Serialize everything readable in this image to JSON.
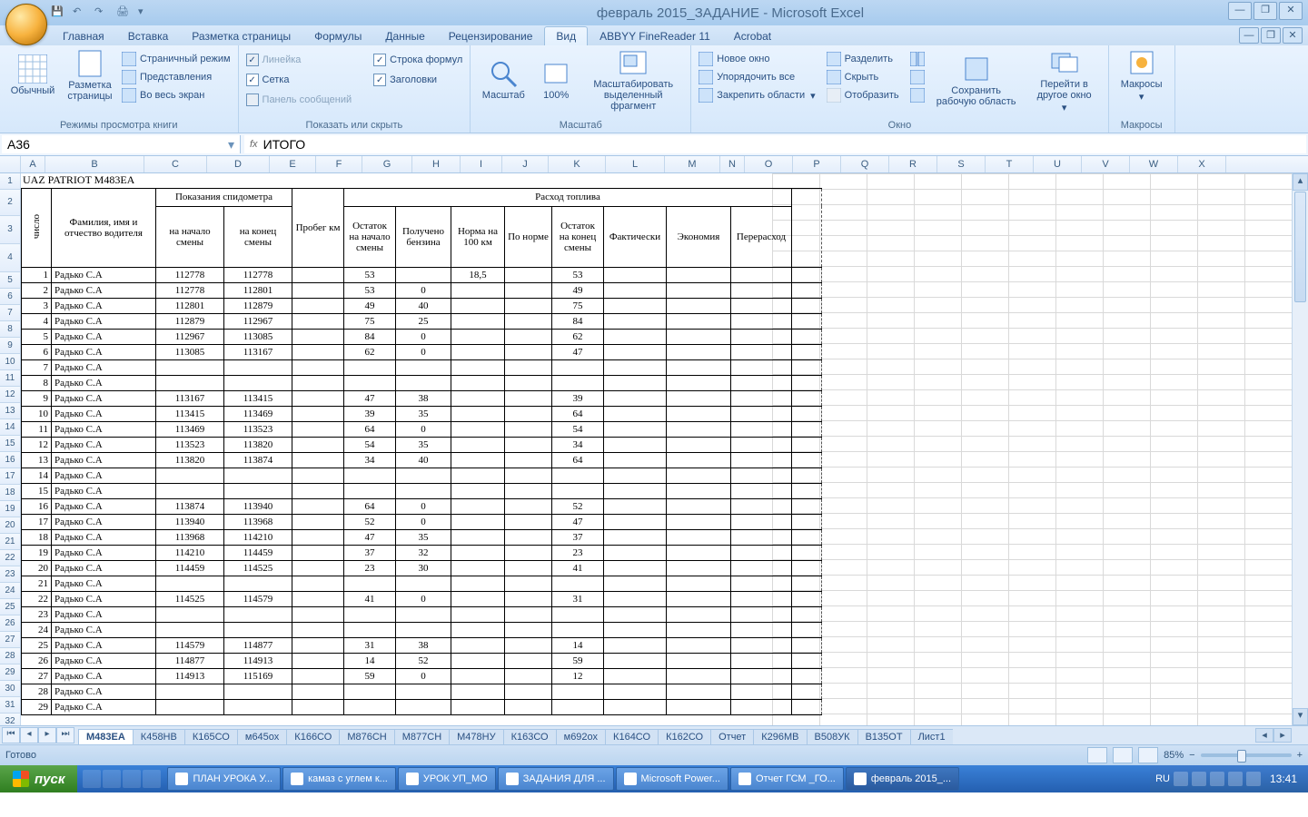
{
  "title": "февраль 2015_ЗАДАНИЕ - Microsoft Excel",
  "ribbonTabs": [
    "Главная",
    "Вставка",
    "Разметка страницы",
    "Формулы",
    "Данные",
    "Рецензирование",
    "Вид",
    "ABBYY FineReader 11",
    "Acrobat"
  ],
  "activeTab": "Вид",
  "ribbon": {
    "g1": {
      "label": "Режимы просмотра книги",
      "b1": "Обычный",
      "b2": "Разметка\nстраницы",
      "i1": "Страничный режим",
      "i2": "Представления",
      "i3": "Во весь экран"
    },
    "g2": {
      "label": "Показать или скрыть",
      "c1": "Линейка",
      "c2": "Сетка",
      "c3": "Панель сообщений",
      "c4": "Строка формул",
      "c5": "Заголовки"
    },
    "g3": {
      "label": "Масштаб",
      "b1": "Масштаб",
      "b2": "100%",
      "b3": "Масштабировать\nвыделенный фрагмент"
    },
    "g4": {
      "label": "Окно",
      "i1": "Новое окно",
      "i2": "Упорядочить все",
      "i3": "Закрепить области",
      "i4": "Разделить",
      "i5": "Скрыть",
      "i6": "Отобразить",
      "b1": "Сохранить\nрабочую область",
      "b2": "Перейти в\nдругое окно"
    },
    "g5": {
      "label": "Макросы",
      "b1": "Макросы"
    }
  },
  "nameBox": "A36",
  "formula": "ИТОГО",
  "cols": [
    "A",
    "B",
    "C",
    "D",
    "E",
    "F",
    "G",
    "H",
    "I",
    "J",
    "K",
    "L",
    "M",
    "N",
    "O",
    "P",
    "Q",
    "R",
    "S",
    "T",
    "U",
    "V",
    "W",
    "X"
  ],
  "sheetTitle": "UAZ PATRIOT  М483ЕА",
  "headers": {
    "num": "число",
    "fio": "Фамилия, имя и отчество водителя",
    "odo": "Показания спидометра",
    "odo1": "на начало смены",
    "odo2": "на конец смены",
    "run": "Пробег км",
    "fuel": "Расход топлива",
    "f1": "Остаток на начало смены",
    "f2": "Получено бензина",
    "f3": "Норма на 100 км",
    "f4": "По норме",
    "f5": "Остаток на конец смены",
    "f6": "Фактически",
    "f7": "Экономия",
    "f8": "Перерасход"
  },
  "rows": [
    {
      "n": "1",
      "d": "Радько С.А",
      "s": "112778",
      "e": "112778",
      "ost": "53",
      "pol": "",
      "nor": "18,5",
      "end": "53"
    },
    {
      "n": "2",
      "d": "Радько С.А",
      "s": "112778",
      "e": "112801",
      "ost": "53",
      "pol": "0",
      "nor": "",
      "end": "49"
    },
    {
      "n": "3",
      "d": "Радько С.А",
      "s": "112801",
      "e": "112879",
      "ost": "49",
      "pol": "40",
      "nor": "",
      "end": "75"
    },
    {
      "n": "4",
      "d": "Радько С.А",
      "s": "112879",
      "e": "112967",
      "ost": "75",
      "pol": "25",
      "nor": "",
      "end": "84"
    },
    {
      "n": "5",
      "d": "Радько С.А",
      "s": "112967",
      "e": "113085",
      "ost": "84",
      "pol": "0",
      "nor": "",
      "end": "62"
    },
    {
      "n": "6",
      "d": "Радько С.А",
      "s": "113085",
      "e": "113167",
      "ost": "62",
      "pol": "0",
      "nor": "",
      "end": "47"
    },
    {
      "n": "7",
      "d": "Радько С.А",
      "s": "",
      "e": "",
      "ost": "",
      "pol": "",
      "nor": "",
      "end": ""
    },
    {
      "n": "8",
      "d": "Радько С.А",
      "s": "",
      "e": "",
      "ost": "",
      "pol": "",
      "nor": "",
      "end": ""
    },
    {
      "n": "9",
      "d": "Радько С.А",
      "s": "113167",
      "e": "113415",
      "ost": "47",
      "pol": "38",
      "nor": "",
      "end": "39"
    },
    {
      "n": "10",
      "d": "Радько С.А",
      "s": "113415",
      "e": "113469",
      "ost": "39",
      "pol": "35",
      "nor": "",
      "end": "64"
    },
    {
      "n": "11",
      "d": "Радько С.А",
      "s": "113469",
      "e": "113523",
      "ost": "64",
      "pol": "0",
      "nor": "",
      "end": "54"
    },
    {
      "n": "12",
      "d": "Радько С.А",
      "s": "113523",
      "e": "113820",
      "ost": "54",
      "pol": "35",
      "nor": "",
      "end": "34"
    },
    {
      "n": "13",
      "d": "Радько С.А",
      "s": "113820",
      "e": "113874",
      "ost": "34",
      "pol": "40",
      "nor": "",
      "end": "64"
    },
    {
      "n": "14",
      "d": "Радько С.А",
      "s": "",
      "e": "",
      "ost": "",
      "pol": "",
      "nor": "",
      "end": ""
    },
    {
      "n": "15",
      "d": "Радько С.А",
      "s": "",
      "e": "",
      "ost": "",
      "pol": "",
      "nor": "",
      "end": ""
    },
    {
      "n": "16",
      "d": "Радько С.А",
      "s": "113874",
      "e": "113940",
      "ost": "64",
      "pol": "0",
      "nor": "",
      "end": "52"
    },
    {
      "n": "17",
      "d": "Радько С.А",
      "s": "113940",
      "e": "113968",
      "ost": "52",
      "pol": "0",
      "nor": "",
      "end": "47"
    },
    {
      "n": "18",
      "d": "Радько С.А",
      "s": "113968",
      "e": "114210",
      "ost": "47",
      "pol": "35",
      "nor": "",
      "end": "37"
    },
    {
      "n": "19",
      "d": "Радько С.А",
      "s": "114210",
      "e": "114459",
      "ost": "37",
      "pol": "32",
      "nor": "",
      "end": "23"
    },
    {
      "n": "20",
      "d": "Радько С.А",
      "s": "114459",
      "e": "114525",
      "ost": "23",
      "pol": "30",
      "nor": "",
      "end": "41"
    },
    {
      "n": "21",
      "d": "Радько С.А",
      "s": "",
      "e": "",
      "ost": "",
      "pol": "",
      "nor": "",
      "end": ""
    },
    {
      "n": "22",
      "d": "Радько С.А",
      "s": "114525",
      "e": "114579",
      "ost": "41",
      "pol": "0",
      "nor": "",
      "end": "31"
    },
    {
      "n": "23",
      "d": "Радько С.А",
      "s": "",
      "e": "",
      "ost": "",
      "pol": "",
      "nor": "",
      "end": ""
    },
    {
      "n": "24",
      "d": "Радько С.А",
      "s": "",
      "e": "",
      "ost": "",
      "pol": "",
      "nor": "",
      "end": ""
    },
    {
      "n": "25",
      "d": "Радько С.А",
      "s": "114579",
      "e": "114877",
      "ost": "31",
      "pol": "38",
      "nor": "",
      "end": "14"
    },
    {
      "n": "26",
      "d": "Радько С.А",
      "s": "114877",
      "e": "114913",
      "ost": "14",
      "pol": "52",
      "nor": "",
      "end": "59"
    },
    {
      "n": "27",
      "d": "Радько С.А",
      "s": "114913",
      "e": "115169",
      "ost": "59",
      "pol": "0",
      "nor": "",
      "end": "12"
    },
    {
      "n": "28",
      "d": "Радько С.А",
      "s": "",
      "e": "",
      "ost": "",
      "pol": "",
      "nor": "",
      "end": ""
    },
    {
      "n": "29",
      "d": "Радько С.А",
      "s": "",
      "e": "",
      "ost": "",
      "pol": "",
      "nor": "",
      "end": ""
    }
  ],
  "sheetTabs": [
    "М483ЕА",
    "К458НВ",
    "К165СО",
    "м645ох",
    "К166СО",
    "М876СН",
    "М877СН",
    "М478НУ",
    "К163СО",
    "м692ох",
    "К164СО",
    "К162СО",
    "Отчет",
    "К296МВ",
    "В508УК",
    "В135ОТ",
    "Лист1"
  ],
  "activeSheet": "М483ЕА",
  "status": {
    "ready": "Готово",
    "zoom": "85%"
  },
  "taskbar": {
    "start": "пуск",
    "items": [
      "ПЛАН УРОКА У...",
      "камаз с углем к...",
      "УРОК УП_МО",
      "ЗАДАНИЯ ДЛЯ ...",
      "Microsoft Power...",
      "Отчет ГСМ _ГО...",
      "февраль 2015_..."
    ],
    "lang": "RU",
    "time": "13:41"
  }
}
